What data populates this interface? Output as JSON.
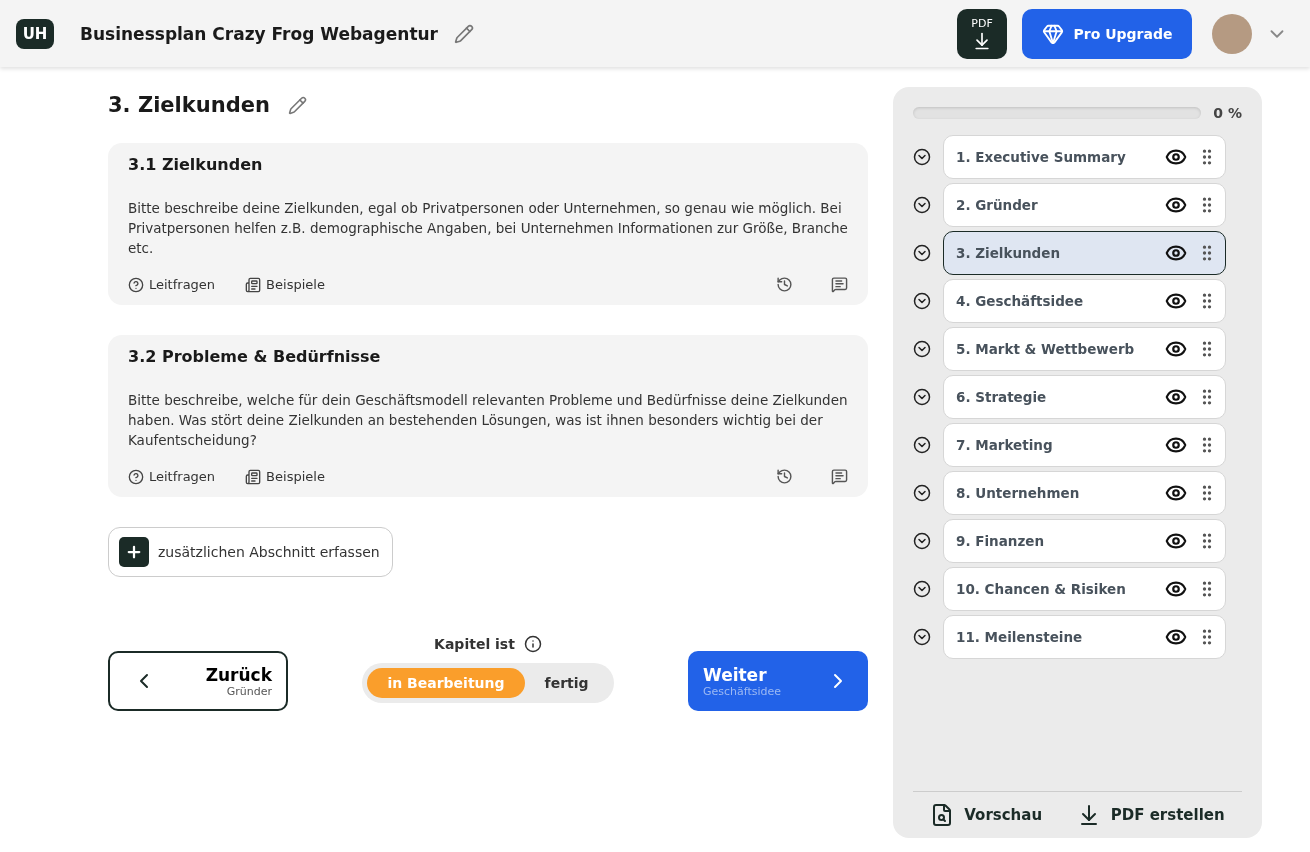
{
  "header": {
    "logo": "UH",
    "title": "Businessplan Crazy Frog Webagentur",
    "pdf_label": "PDF",
    "upgrade": "Pro Upgrade"
  },
  "chapter": {
    "title": "3. Zielkunden"
  },
  "sections": [
    {
      "title": "3.1 Zielkunden",
      "text": "Bitte beschreibe deine Zielkunden, egal ob Privatpersonen oder Unternehmen, so genau wie möglich. Bei Privatpersonen helfen z.B. demographische Angaben, bei Unternehmen Informationen zur Größe, Branche etc.",
      "links": [
        "Leitfragen",
        "Beispiele"
      ]
    },
    {
      "title": "3.2 Probleme & Bedürfnisse",
      "text": "Bitte beschreibe, welche für dein Geschäftsmodell relevanten Probleme und Bedürfnisse deine Zielkunden haben. Was stört deine Zielkunden an bestehenden Lösungen, was ist ihnen besonders wichtig bei der Kaufentscheidung?",
      "links": [
        "Leitfragen",
        "Beispiele"
      ]
    }
  ],
  "add_section": "zusätzlichen Abschnitt erfassen",
  "nav": {
    "back": {
      "label": "Zurück",
      "sub": "Gründer"
    },
    "next": {
      "label": "Weiter",
      "sub": "Geschäftsidee"
    },
    "status_label": "Kapitel ist",
    "status_options": [
      {
        "label": "in Bearbeitung",
        "selected": true
      },
      {
        "label": "fertig",
        "selected": false
      }
    ]
  },
  "sidebar": {
    "progress": {
      "level": 0,
      "reading": "0 %"
    },
    "chapters": [
      {
        "label": "1. Executive Summary",
        "selected": false
      },
      {
        "label": "2. Gründer",
        "selected": false
      },
      {
        "label": "3. Zielkunden",
        "selected": true
      },
      {
        "label": "4. Geschäftsidee",
        "selected": false
      },
      {
        "label": "5. Markt & Wettbewerb",
        "selected": false
      },
      {
        "label": "6. Strategie",
        "selected": false
      },
      {
        "label": "7. Marketing",
        "selected": false
      },
      {
        "label": "8. Unternehmen",
        "selected": false
      },
      {
        "label": "9. Finanzen",
        "selected": false
      },
      {
        "label": "10. Chancen & Risiken",
        "selected": false
      },
      {
        "label": "11. Meilensteine",
        "selected": false
      }
    ],
    "footer": [
      "Vorschau",
      "PDF erstellen"
    ]
  }
}
